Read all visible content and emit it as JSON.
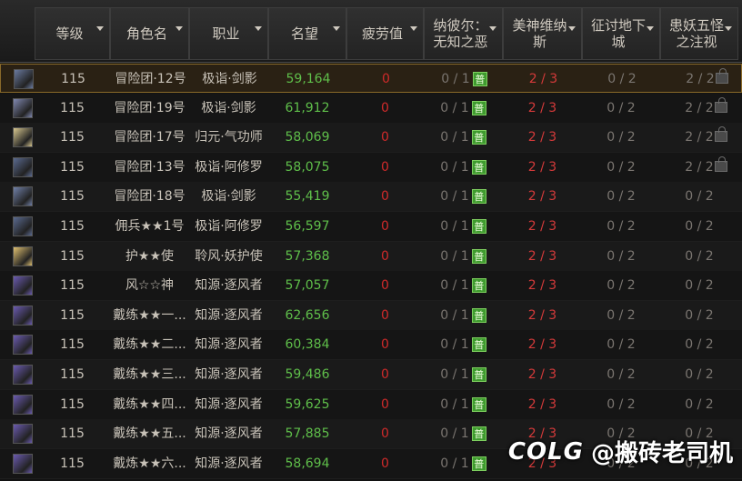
{
  "headers": {
    "level": "等级",
    "name": "角色名",
    "job": "职业",
    "fame": "名望",
    "fatigue": "疲劳值",
    "dungeon1": "纳彼尔：\n无知之恶",
    "dungeon2": "美神维纳\n斯",
    "dungeon3": "征讨地下\n城",
    "dungeon4": "患妖五怪\n之注视"
  },
  "pu_label": "普",
  "rows": [
    {
      "level": "115",
      "name": "冒险团·12号",
      "job": "极诣·剑影",
      "fame": "59,164",
      "fatigue": "0",
      "d1": "0 / 1",
      "d2": "2 / 3",
      "d3": "0 / 2",
      "d4": "2 / 2",
      "avatar": "#6a7aa0",
      "locked": true,
      "selected": true
    },
    {
      "level": "115",
      "name": "冒险团·19号",
      "job": "极诣·剑影",
      "fame": "61,912",
      "fatigue": "0",
      "d1": "0 / 1",
      "d2": "2 / 3",
      "d3": "0 / 2",
      "d4": "2 / 2",
      "avatar": "#8088b0",
      "locked": true
    },
    {
      "level": "115",
      "name": "冒险团·17号",
      "job": "归元·气功师",
      "fame": "58,069",
      "fatigue": "0",
      "d1": "0 / 1",
      "d2": "2 / 3",
      "d3": "0 / 2",
      "d4": "2 / 2",
      "avatar": "#d8c890",
      "locked": true
    },
    {
      "level": "115",
      "name": "冒险团·13号",
      "job": "极诣·阿修罗",
      "fame": "58,075",
      "fatigue": "0",
      "d1": "0 / 1",
      "d2": "2 / 3",
      "d3": "0 / 2",
      "d4": "2 / 2",
      "avatar": "#5a6a90",
      "locked": true
    },
    {
      "level": "115",
      "name": "冒险团·18号",
      "job": "极诣·剑影",
      "fame": "55,419",
      "fatigue": "0",
      "d1": "0 / 1",
      "d2": "2 / 3",
      "d3": "0 / 2",
      "d4": "0 / 2",
      "avatar": "#7080a8",
      "locked": false
    },
    {
      "level": "115",
      "name": "佣兵★★1号",
      "job": "极诣·阿修罗",
      "fame": "56,597",
      "fatigue": "0",
      "d1": "0 / 1",
      "d2": "2 / 3",
      "d3": "0 / 2",
      "d4": "0 / 2",
      "avatar": "#5a6a90",
      "locked": false
    },
    {
      "level": "115",
      "name": "护★★使",
      "job": "聆风·妖护使",
      "fame": "57,368",
      "fatigue": "0",
      "d1": "0 / 1",
      "d2": "2 / 3",
      "d3": "0 / 2",
      "d4": "0 / 2",
      "avatar": "#e0c070",
      "locked": false
    },
    {
      "level": "115",
      "name": "风☆☆神",
      "job": "知源·逐风者",
      "fame": "57,057",
      "fatigue": "0",
      "d1": "0 / 1",
      "d2": "2 / 3",
      "d3": "0 / 2",
      "d4": "0 / 2",
      "avatar": "#6a5ab0",
      "locked": false
    },
    {
      "level": "115",
      "name": "戴练★★一...",
      "job": "知源·逐风者",
      "fame": "62,656",
      "fatigue": "0",
      "d1": "0 / 1",
      "d2": "2 / 3",
      "d3": "0 / 2",
      "d4": "0 / 2",
      "avatar": "#6a5ab0",
      "locked": false
    },
    {
      "level": "115",
      "name": "戴练★★二...",
      "job": "知源·逐风者",
      "fame": "60,384",
      "fatigue": "0",
      "d1": "0 / 1",
      "d2": "2 / 3",
      "d3": "0 / 2",
      "d4": "0 / 2",
      "avatar": "#6a5ab0",
      "locked": false
    },
    {
      "level": "115",
      "name": "戴练★★三...",
      "job": "知源·逐风者",
      "fame": "59,486",
      "fatigue": "0",
      "d1": "0 / 1",
      "d2": "2 / 3",
      "d3": "0 / 2",
      "d4": "0 / 2",
      "avatar": "#6a5ab0",
      "locked": false
    },
    {
      "level": "115",
      "name": "戴练★★四...",
      "job": "知源·逐风者",
      "fame": "59,625",
      "fatigue": "0",
      "d1": "0 / 1",
      "d2": "2 / 3",
      "d3": "0 / 2",
      "d4": "0 / 2",
      "avatar": "#6a5ab0",
      "locked": false
    },
    {
      "level": "115",
      "name": "戴练★★五...",
      "job": "知源·逐风者",
      "fame": "57,885",
      "fatigue": "0",
      "d1": "0 / 1",
      "d2": "2 / 3",
      "d3": "0 / 2",
      "d4": "0 / 2",
      "avatar": "#6a5ab0",
      "locked": false
    },
    {
      "level": "115",
      "name": "戴炼★★六...",
      "job": "知源·逐风者",
      "fame": "58,694",
      "fatigue": "0",
      "d1": "0 / 1",
      "d2": "2 / 3",
      "d3": "0 / 2",
      "d4": "0 / 2",
      "avatar": "#6a5ab0",
      "locked": false
    }
  ],
  "watermark": {
    "logo": "COLG",
    "text": "@搬砖老司机"
  }
}
